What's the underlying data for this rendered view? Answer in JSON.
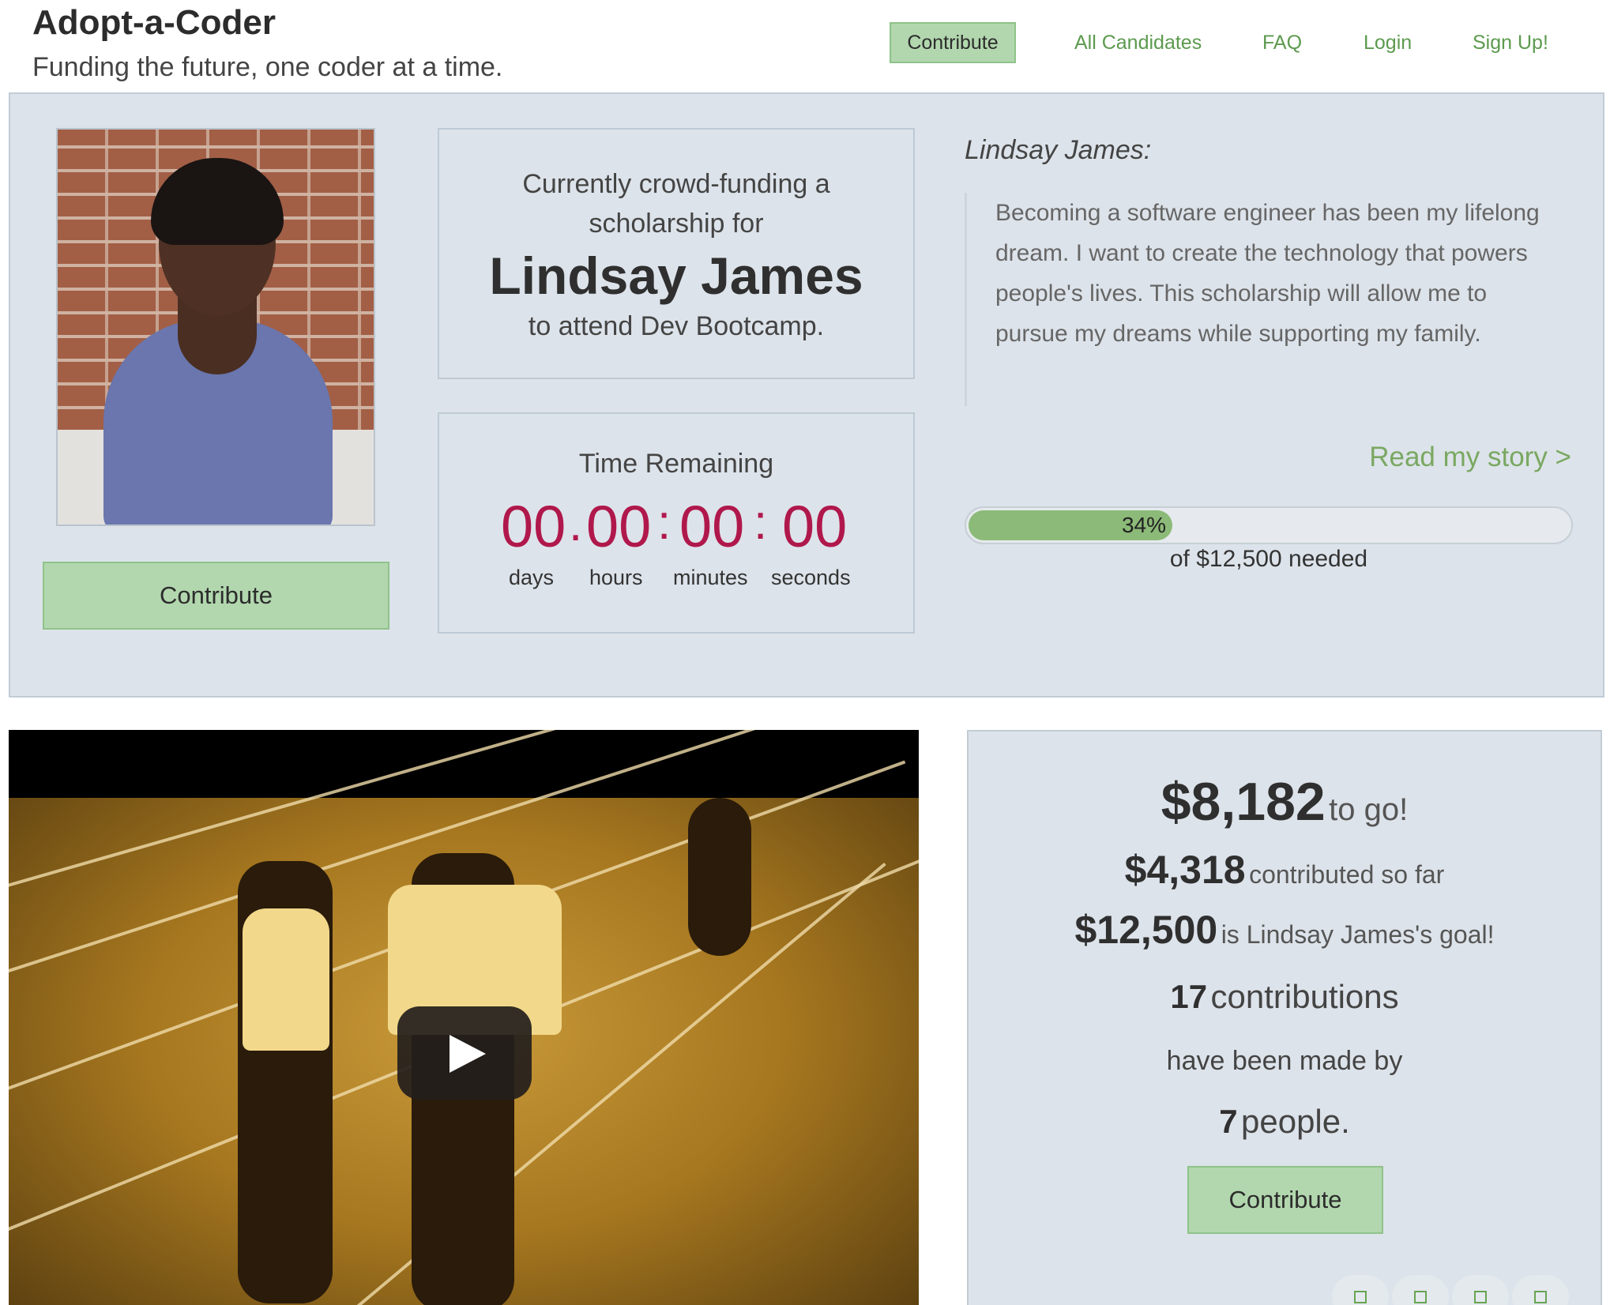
{
  "header": {
    "site_title": "Adopt-a-Coder",
    "tagline": "Funding the future, one coder at a time.",
    "nav": {
      "contribute": "Contribute",
      "all_candidates": "All Candidates",
      "faq": "FAQ",
      "login": "Login",
      "sign_up": "Sign Up!"
    }
  },
  "hero": {
    "contribute_label": "Contribute",
    "funding_line_1": "Currently crowd-funding a",
    "funding_line_2": "scholarship for",
    "candidate_name": "Lindsay James",
    "funding_line_3": "to attend Dev Bootcamp.",
    "timer": {
      "title": "Time Remaining",
      "days": "00",
      "hours": "00",
      "minutes": "00",
      "seconds": "00",
      "units": [
        "days",
        "hours",
        "minutes",
        "seconds"
      ]
    },
    "bio_name": "Lindsay James:",
    "bio_quote": "Becoming a software engineer has been my lifelong dream. I want to create the technology that powers people's lives. This scholarship will allow me to pursue my dreams while supporting my family.",
    "read_story": "Read my story >",
    "progress": {
      "percent": 34,
      "label": "34%",
      "caption": "of $12,500 needed"
    }
  },
  "stats": {
    "to_go_amount": "$8,182",
    "to_go_label": "to go!",
    "contributed_amount": "$4,318",
    "contributed_label": "contributed so far",
    "goal_amount": "$12,500",
    "goal_label": "is Lindsay James's goal!",
    "contributions_count": "17",
    "contributions_label": "contributions",
    "made_by_label": "have been made by",
    "people_count": "7",
    "people_label": "people.",
    "contribute_label": "Contribute"
  },
  "colors": {
    "button_green": "#b2d7ae",
    "link_green": "#5c9a4e",
    "timer_red": "#b0184c",
    "panel_bg": "#dde3ea",
    "progress_fill": "#8cba78"
  },
  "icons": {
    "video_play": "play-icon",
    "carousel": "square-dot-icon"
  }
}
